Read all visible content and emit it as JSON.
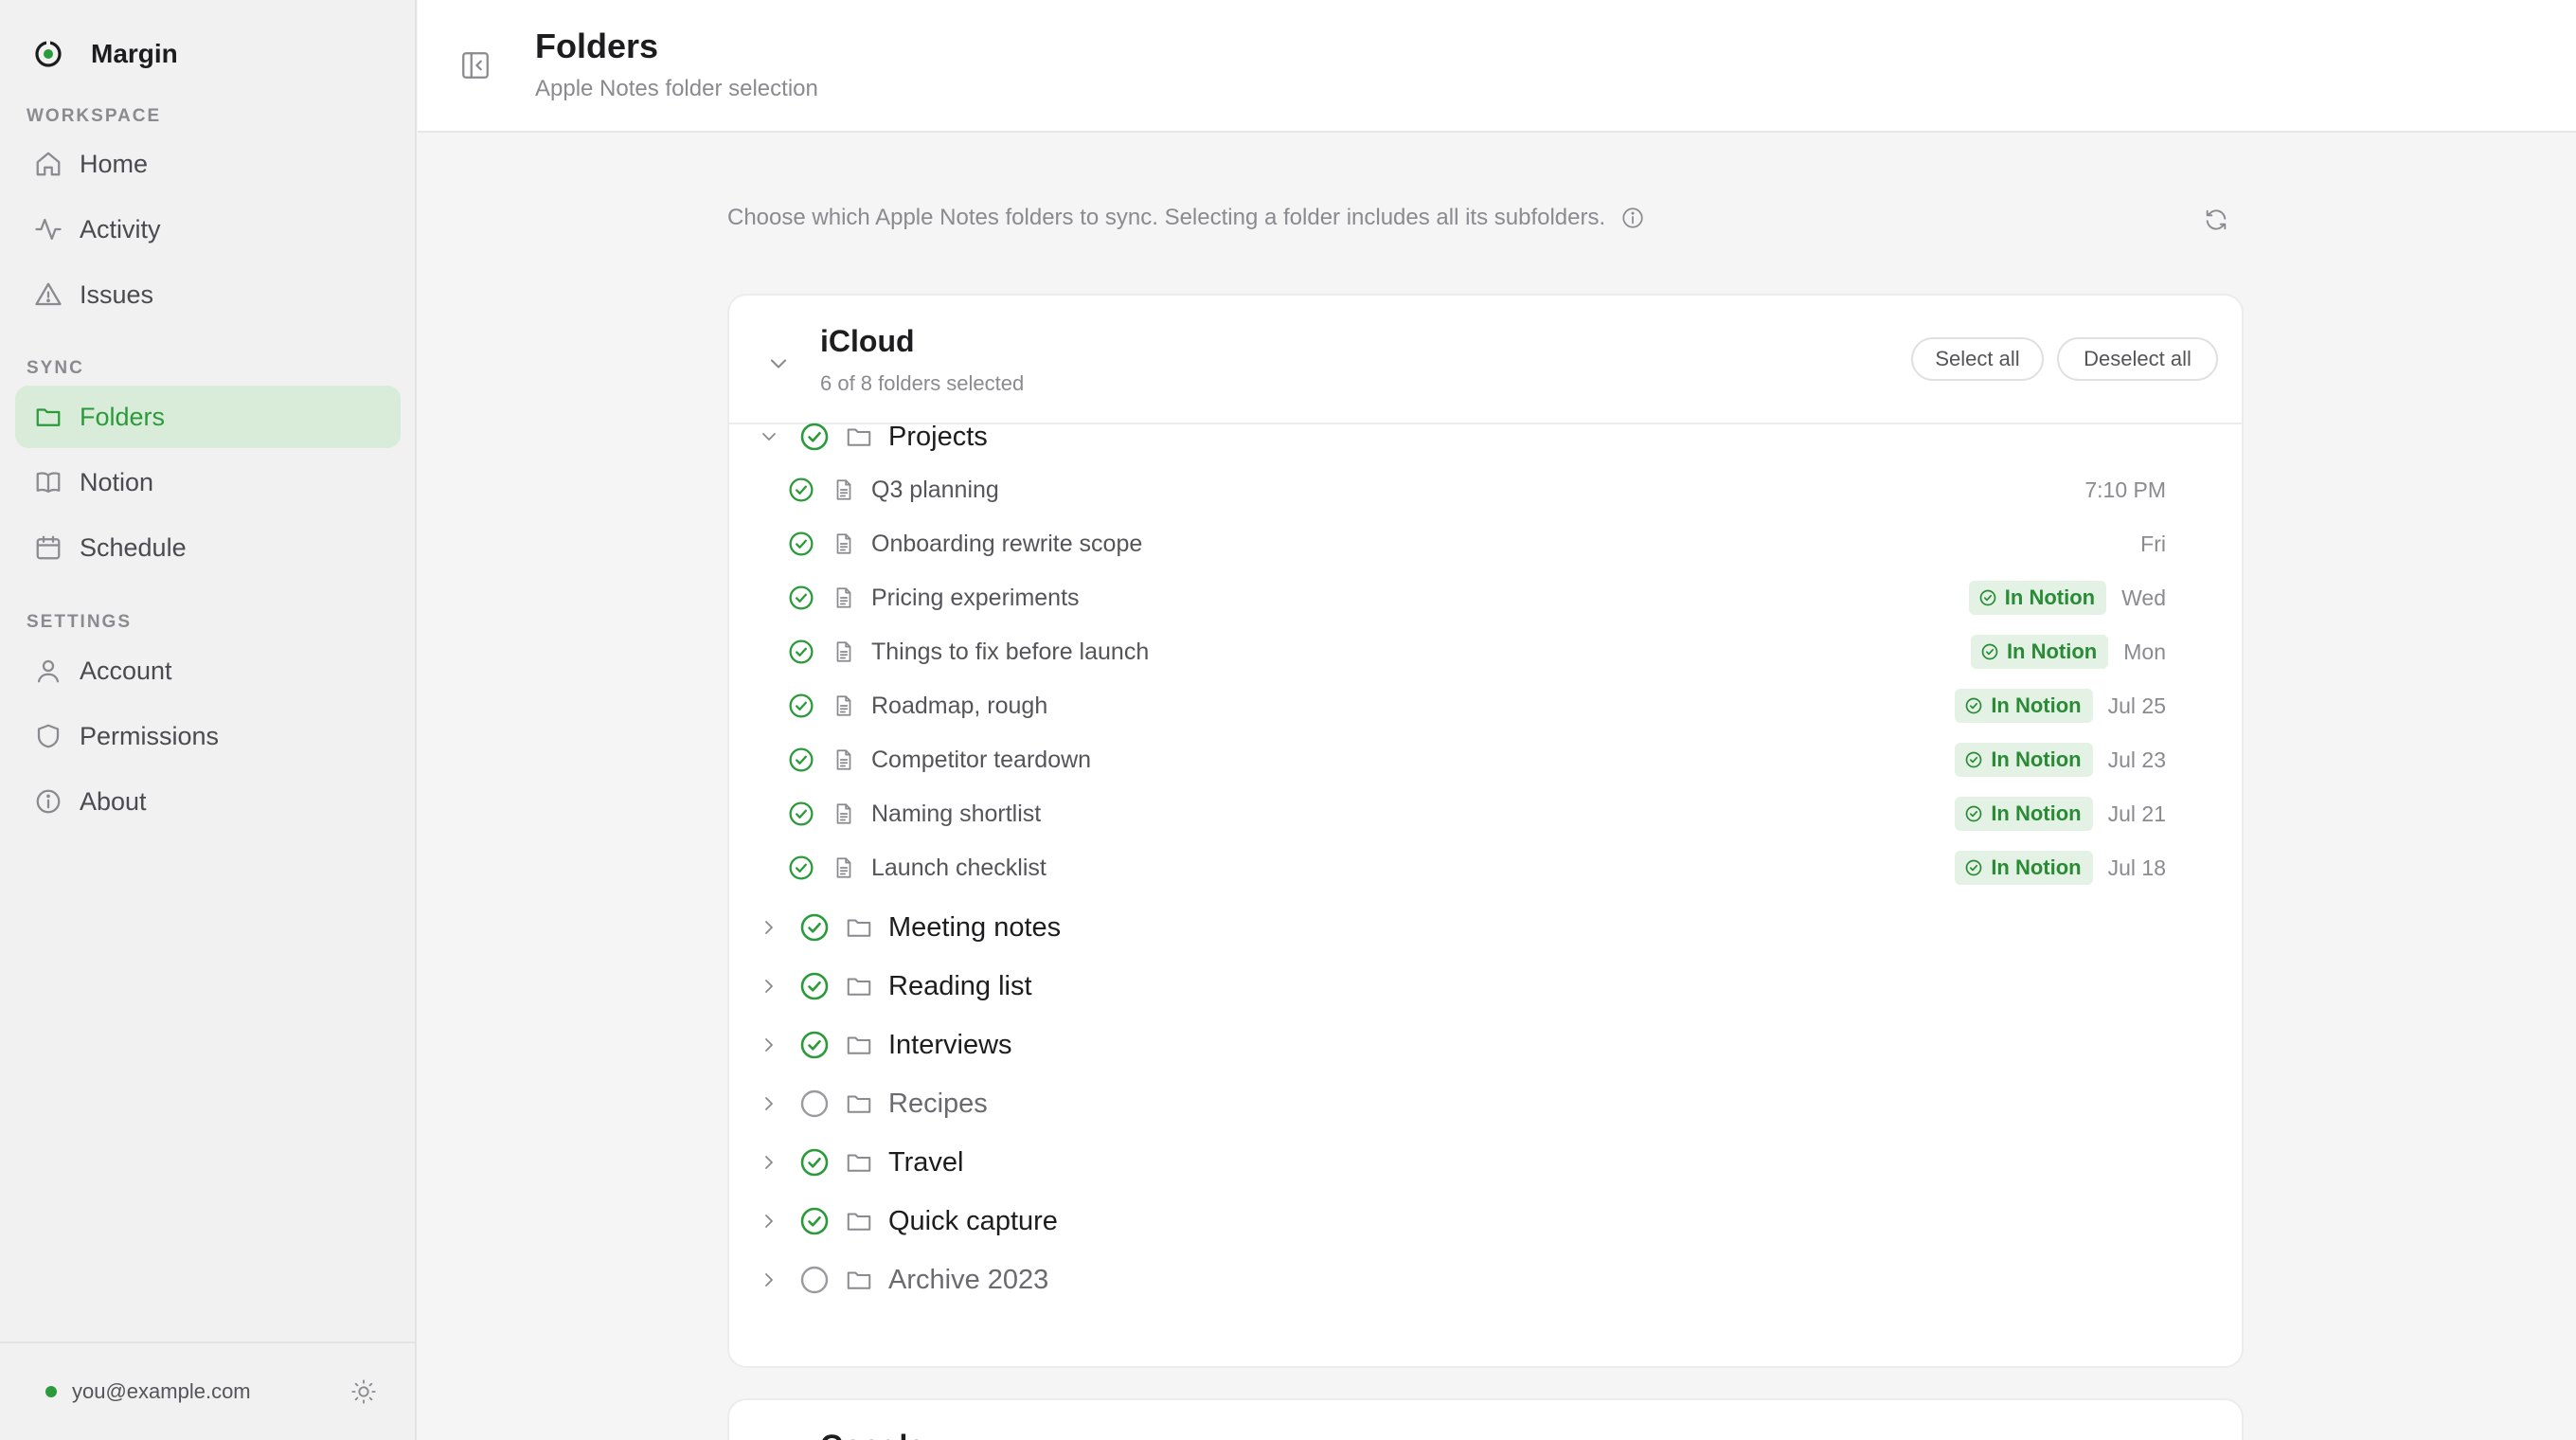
{
  "app": {
    "name": "Margin"
  },
  "sidebar": {
    "sections": {
      "workspace": "WORKSPACE",
      "sync": "SYNC",
      "settings": "SETTINGS"
    },
    "items": [
      {
        "label": "Home",
        "icon": "home-icon"
      },
      {
        "label": "Activity",
        "icon": "activity-icon"
      },
      {
        "label": "Issues",
        "icon": "warning-icon"
      },
      {
        "label": "Folders",
        "icon": "folder-icon",
        "active": true
      },
      {
        "label": "Notion",
        "icon": "book-icon"
      },
      {
        "label": "Schedule",
        "icon": "calendar-icon"
      },
      {
        "label": "Account",
        "icon": "user-icon"
      },
      {
        "label": "Permissions",
        "icon": "shield-icon"
      },
      {
        "label": "About",
        "icon": "info-icon"
      }
    ],
    "footer": {
      "email": "you@example.com",
      "status": "online"
    }
  },
  "header": {
    "title": "Folders",
    "subtitle": "Apple Notes folder selection"
  },
  "main": {
    "intro": "Choose which Apple Notes folders to sync. Selecting a folder includes all its subfolders.",
    "accounts": [
      {
        "name": "iCloud",
        "count": "6 of 8 folders selected",
        "select_all": "Select all",
        "deselect_all": "Deselect all",
        "folders": [
          {
            "name": "Projects",
            "selected": true,
            "expanded": true,
            "notes": [
              {
                "name": "Q3 planning",
                "date": "7:10 PM",
                "badge": ""
              },
              {
                "name": "Onboarding rewrite scope",
                "date": "Fri",
                "badge": ""
              },
              {
                "name": "Pricing experiments",
                "date": "Wed",
                "badge": "In Notion"
              },
              {
                "name": "Things to fix before launch",
                "date": "Mon",
                "badge": "In Notion"
              },
              {
                "name": "Roadmap, rough",
                "date": "Jul 25",
                "badge": "In Notion"
              },
              {
                "name": "Competitor teardown",
                "date": "Jul 23",
                "badge": "In Notion"
              },
              {
                "name": "Naming shortlist",
                "date": "Jul 21",
                "badge": "In Notion"
              },
              {
                "name": "Launch checklist",
                "date": "Jul 18",
                "badge": "In Notion"
              }
            ]
          },
          {
            "name": "Meeting notes",
            "selected": true,
            "expanded": false
          },
          {
            "name": "Reading list",
            "selected": true,
            "expanded": false
          },
          {
            "name": "Interviews",
            "selected": true,
            "expanded": false
          },
          {
            "name": "Recipes",
            "selected": false,
            "expanded": false
          },
          {
            "name": "Travel",
            "selected": true,
            "expanded": false
          },
          {
            "name": "Quick capture",
            "selected": true,
            "expanded": false
          },
          {
            "name": "Archive 2023",
            "selected": false,
            "expanded": false
          }
        ]
      },
      {
        "name": "Google"
      }
    ]
  },
  "colors": {
    "accent": "#2a9a3a",
    "badge_bg": "#e3f2e4",
    "active_nav_bg": "#d9ecd9"
  }
}
